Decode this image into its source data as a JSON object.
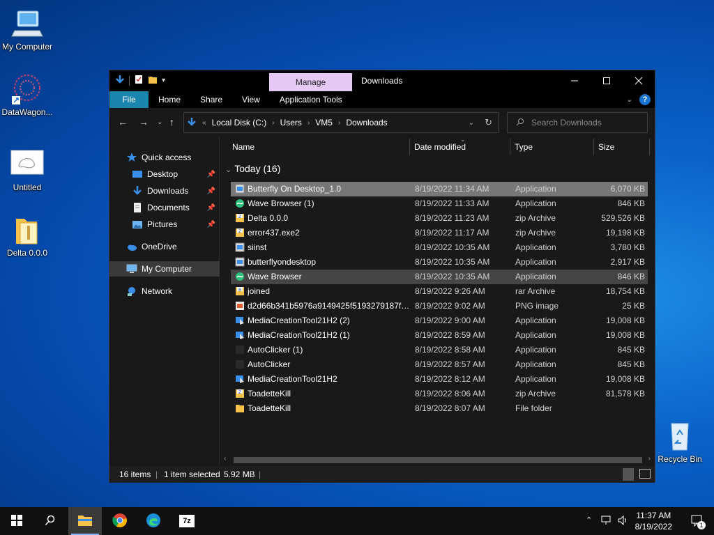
{
  "desktop": {
    "icons": [
      {
        "label": "My Computer",
        "icon": "computer-icon"
      },
      {
        "label": "DataWagon...",
        "icon": "shortcut-icon"
      },
      {
        "label": "Untitled",
        "icon": "image-icon"
      },
      {
        "label": "Delta 0.0.0",
        "icon": "folder-icon"
      },
      {
        "label": "Recycle Bin",
        "icon": "recycle-bin-icon"
      }
    ]
  },
  "window": {
    "manage_tab": "Manage",
    "title": "Downloads",
    "ribbon_tabs": [
      "File",
      "Home",
      "Share",
      "View",
      "Application Tools"
    ],
    "colors": {
      "file_tab": "#1a86b0",
      "manage_tab": "#e6c8f5",
      "selection": "#777777"
    }
  },
  "address": {
    "crumbs": [
      "Local Disk (C:)",
      "Users",
      "VM5",
      "Downloads"
    ],
    "overflow": "«"
  },
  "search": {
    "placeholder": "Search Downloads"
  },
  "nav": {
    "quick_access": "Quick access",
    "items": [
      "Desktop",
      "Downloads",
      "Documents",
      "Pictures"
    ],
    "onedrive": "OneDrive",
    "my_computer": "My Computer",
    "network": "Network"
  },
  "columns": {
    "name": "Name",
    "date": "Date modified",
    "type": "Type",
    "size": "Size"
  },
  "group": "Today (16)",
  "files": [
    {
      "name": "Butterfly On Desktop_1.0",
      "date": "8/19/2022 11:34 AM",
      "type": "Application",
      "size": "6,070 KB",
      "icon": "app-icon"
    },
    {
      "name": "Wave Browser (1)",
      "date": "8/19/2022 11:33 AM",
      "type": "Application",
      "size": "846 KB",
      "icon": "wave-icon"
    },
    {
      "name": "Delta 0.0.0",
      "date": "8/19/2022 11:23 AM",
      "type": "zip Archive",
      "size": "529,526 KB",
      "icon": "zip-icon"
    },
    {
      "name": "error437.exe2",
      "date": "8/19/2022 11:17 AM",
      "type": "zip Archive",
      "size": "19,198 KB",
      "icon": "zip-icon"
    },
    {
      "name": "siinst",
      "date": "8/19/2022 10:35 AM",
      "type": "Application",
      "size": "3,780 KB",
      "icon": "app-icon"
    },
    {
      "name": "butterflyondesktop",
      "date": "8/19/2022 10:35 AM",
      "type": "Application",
      "size": "2,917 KB",
      "icon": "app-icon"
    },
    {
      "name": "Wave Browser",
      "date": "8/19/2022 10:35 AM",
      "type": "Application",
      "size": "846 KB",
      "icon": "wave-icon"
    },
    {
      "name": "joined",
      "date": "8/19/2022 9:26 AM",
      "type": "rar Archive",
      "size": "18,754 KB",
      "icon": "rar-icon"
    },
    {
      "name": "d2d66b341b5976a9149425f5193279187f0c...",
      "date": "8/19/2022 9:02 AM",
      "type": "PNG image",
      "size": "25 KB",
      "icon": "png-icon"
    },
    {
      "name": "MediaCreationTool21H2 (2)",
      "date": "8/19/2022 9:00 AM",
      "type": "Application",
      "size": "19,008 KB",
      "icon": "media-tool-icon"
    },
    {
      "name": "MediaCreationTool21H2 (1)",
      "date": "8/19/2022 8:59 AM",
      "type": "Application",
      "size": "19,008 KB",
      "icon": "media-tool-icon"
    },
    {
      "name": "AutoClicker (1)",
      "date": "8/19/2022 8:58 AM",
      "type": "Application",
      "size": "845 KB",
      "icon": "blank-icon"
    },
    {
      "name": "AutoClicker",
      "date": "8/19/2022 8:57 AM",
      "type": "Application",
      "size": "845 KB",
      "icon": "blank-icon"
    },
    {
      "name": "MediaCreationTool21H2",
      "date": "8/19/2022 8:12 AM",
      "type": "Application",
      "size": "19,008 KB",
      "icon": "media-tool-icon"
    },
    {
      "name": "ToadetteKill",
      "date": "8/19/2022 8:06 AM",
      "type": "zip Archive",
      "size": "81,578 KB",
      "icon": "zip-icon"
    },
    {
      "name": "ToadetteKill",
      "date": "8/19/2022 8:07 AM",
      "type": "File folder",
      "size": "",
      "icon": "folder-icon"
    }
  ],
  "status": {
    "count": "16 items",
    "selected": "1 item selected",
    "size": "5.92 MB"
  },
  "taskbar": {
    "time": "11:37 AM",
    "date": "8/19/2022",
    "notifications": "1"
  }
}
